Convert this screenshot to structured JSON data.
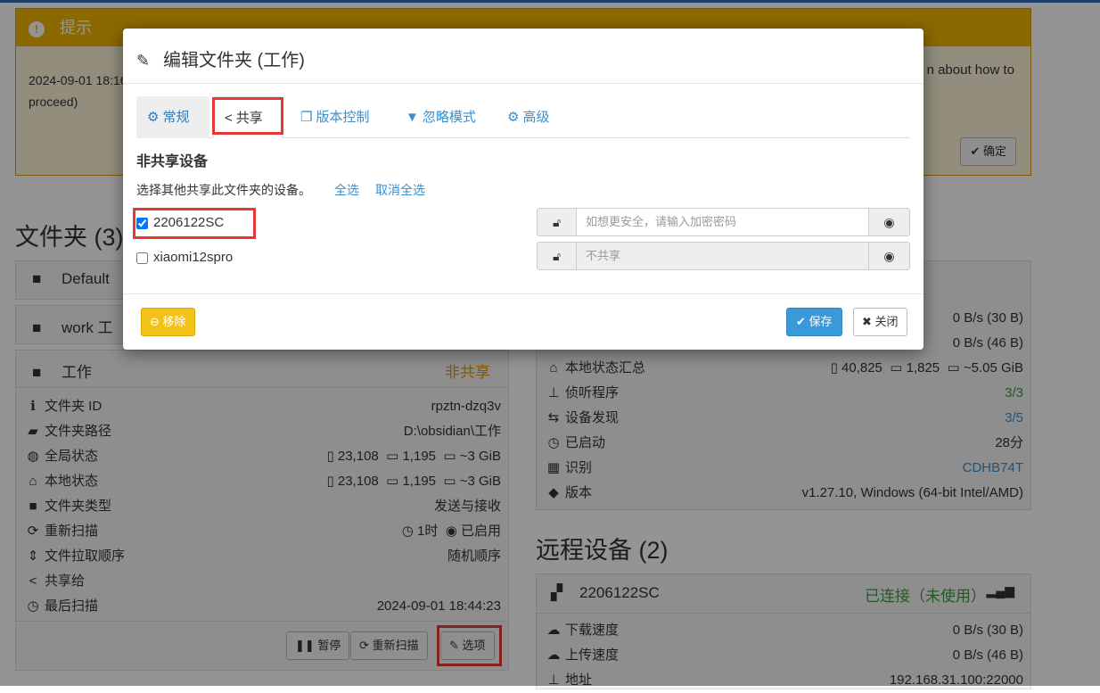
{
  "alert": {
    "title": "提示",
    "body_left": "2024-09-01 18:16",
    "body_line2": "proceed)",
    "body_right": "n about how to",
    "ok_label": "确定"
  },
  "folders": {
    "heading": "文件夹 (3)",
    "items": [
      {
        "name": "Default"
      },
      {
        "name": "work 工"
      },
      {
        "name": "工作",
        "status": "非共享"
      }
    ],
    "details": [
      {
        "label": "文件夹 ID",
        "value": "rpztn-dzq3v"
      },
      {
        "label": "文件夹路径",
        "value": "D:\\obsidian\\工作"
      },
      {
        "label": "全局状态",
        "files": "23,108",
        "dirs": "1,195",
        "size": "~3 GiB"
      },
      {
        "label": "本地状态",
        "files": "23,108",
        "dirs": "1,195",
        "size": "~3 GiB"
      },
      {
        "label": "文件夹类型",
        "value": "发送与接收"
      },
      {
        "label": "重新扫描",
        "interval": "1时",
        "enabled": "已启用"
      },
      {
        "label": "文件拉取顺序",
        "value": "随机顺序"
      },
      {
        "label": "共享给",
        "value": ""
      },
      {
        "label": "最后扫描",
        "value": "2024-09-01 18:44:23"
      }
    ],
    "buttons": {
      "pause": "暂停",
      "rescan": "重新扫描",
      "options": "选项"
    }
  },
  "this_device": {
    "rows": [
      {
        "label": "",
        "value": "0 B/s (30 B)"
      },
      {
        "label": "",
        "value": "0 B/s (46 B)"
      },
      {
        "label": "本地状态汇总",
        "files": "40,825",
        "dirs": "1,825",
        "size": "~5.05 GiB"
      },
      {
        "label": "侦听程序",
        "value": "3/3"
      },
      {
        "label": "设备发现",
        "value": "3/5"
      },
      {
        "label": "已启动",
        "value": "28分"
      },
      {
        "label": "识别",
        "value": "CDHB74T"
      },
      {
        "label": "版本",
        "value": "v1.27.10, Windows (64-bit Intel/AMD)"
      }
    ]
  },
  "remote": {
    "heading": "远程设备 (2)",
    "device_name": "2206122SC",
    "device_status": "已连接（未使用）",
    "rows": [
      {
        "label": "下载速度",
        "value": "0 B/s (30 B)"
      },
      {
        "label": "上传速度",
        "value": "0 B/s (46 B)"
      },
      {
        "label": "地址",
        "value": "192.168.31.100:22000"
      }
    ]
  },
  "modal": {
    "title": "编辑文件夹 (工作)",
    "tabs": [
      {
        "label": "常规",
        "icon": "gear-icon"
      },
      {
        "label": "共享",
        "icon": "share-icon"
      },
      {
        "label": "版本控制",
        "icon": "copy-icon"
      },
      {
        "label": "忽略模式",
        "icon": "filter-icon"
      },
      {
        "label": "高级",
        "icon": "cogs-icon"
      }
    ],
    "section_title": "非共享设备",
    "help_text": "选择其他共享此文件夹的设备。",
    "select_all": "全选",
    "deselect_all": "取消全选",
    "devices": [
      {
        "name": "2206122SC",
        "checked": true,
        "password_placeholder": "如想更安全，请输入加密密码"
      },
      {
        "name": "xiaomi12spro",
        "checked": false,
        "password_placeholder": "不共享"
      }
    ],
    "remove_label": "移除",
    "save_label": "保存",
    "close_label": "关闭"
  },
  "colors": {
    "alert_header": "#f0b400",
    "accent_blue": "#3a8fcc",
    "highlight_red": "#e53935",
    "remove_yellow": "#f3c21a",
    "save_blue": "#3a9ad9"
  }
}
